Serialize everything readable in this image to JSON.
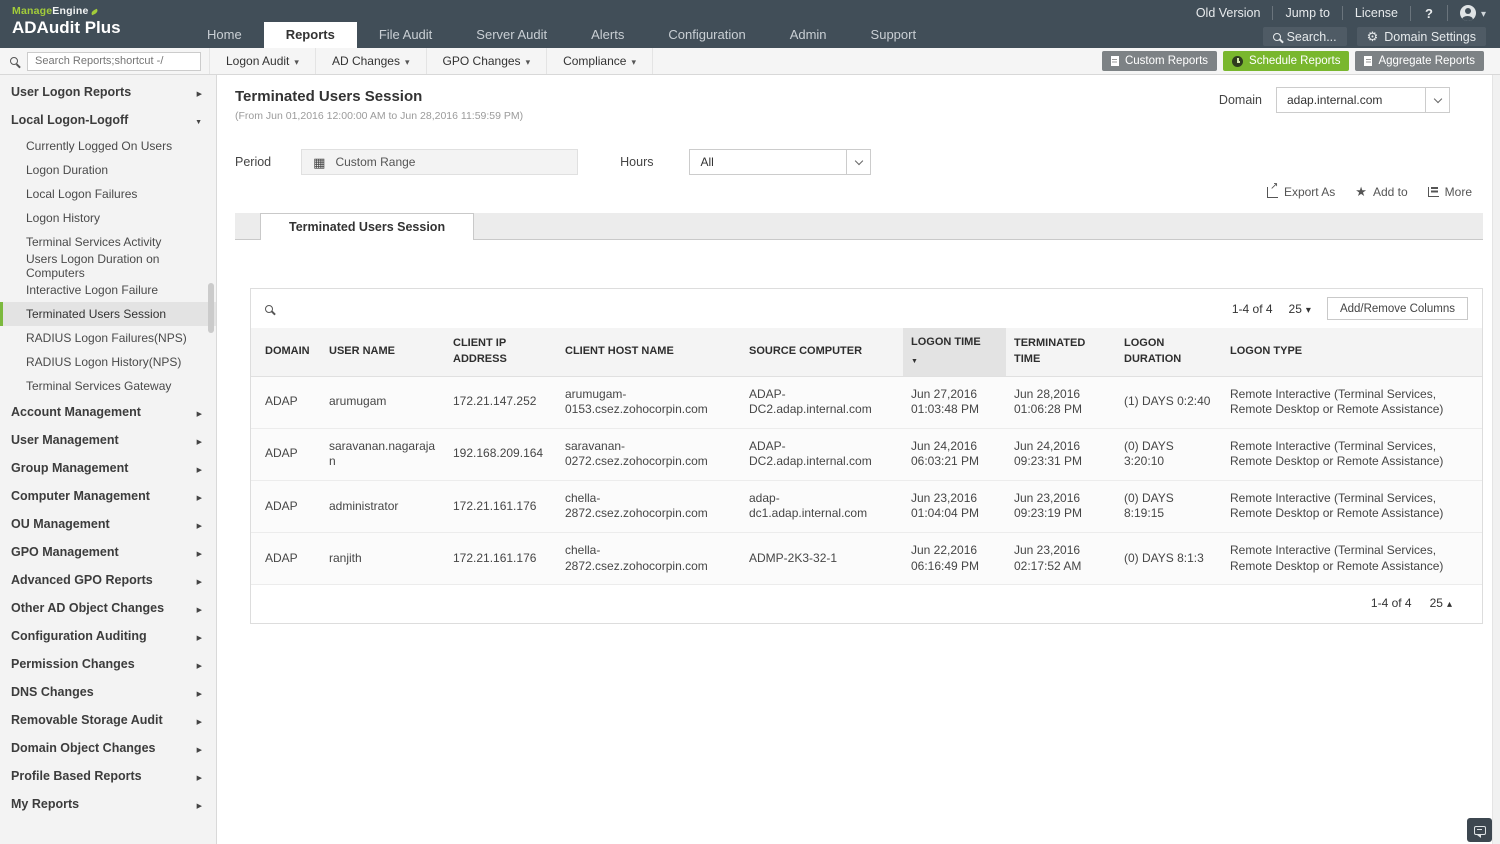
{
  "colors": {
    "header_bg": "#414e58",
    "accent_green": "#7cb93e",
    "button_green": "#79b72e",
    "button_gray": "#7d8285"
  },
  "brand": {
    "manage": "Manage",
    "engine": "Engine",
    "product": "ADAudit Plus"
  },
  "header": {
    "nav": [
      {
        "label": "Home"
      },
      {
        "label": "Reports",
        "active": true
      },
      {
        "label": "File Audit"
      },
      {
        "label": "Server Audit"
      },
      {
        "label": "Alerts"
      },
      {
        "label": "Configuration"
      },
      {
        "label": "Admin"
      },
      {
        "label": "Support"
      }
    ],
    "quick_links": [
      "Old Version",
      "Jump to",
      "License"
    ],
    "help_icon": "?",
    "search_label": "Search...",
    "domain_settings_label": "Domain Settings"
  },
  "toolbar": {
    "search_placeholder": "Search Reports;shortcut -/",
    "menus": [
      {
        "label": "Logon Audit"
      },
      {
        "label": "AD Changes"
      },
      {
        "label": "GPO Changes"
      },
      {
        "label": "Compliance"
      }
    ],
    "action_buttons": [
      {
        "label": "Custom Reports",
        "style": "gray",
        "icon": "report-icon"
      },
      {
        "label": "Schedule Reports",
        "style": "green",
        "icon": "clock-icon"
      },
      {
        "label": "Aggregate Reports",
        "style": "gray",
        "icon": "report-icon"
      }
    ]
  },
  "sidebar": {
    "items": [
      {
        "label": "User Logon Reports",
        "type": "section",
        "arrow": "right"
      },
      {
        "label": "Local Logon-Logoff",
        "type": "section",
        "arrow": "down"
      },
      {
        "label": "Currently Logged On Users",
        "type": "sub"
      },
      {
        "label": "Logon Duration",
        "type": "sub"
      },
      {
        "label": "Local Logon Failures",
        "type": "sub"
      },
      {
        "label": "Logon History",
        "type": "sub"
      },
      {
        "label": "Terminal Services Activity",
        "type": "sub"
      },
      {
        "label": "Users Logon Duration on Computers",
        "type": "sub"
      },
      {
        "label": "Interactive Logon Failure",
        "type": "sub"
      },
      {
        "label": "Terminated Users Session",
        "type": "sub",
        "active": true
      },
      {
        "label": "RADIUS Logon Failures(NPS)",
        "type": "sub"
      },
      {
        "label": "RADIUS Logon History(NPS)",
        "type": "sub"
      },
      {
        "label": "Terminal Services Gateway",
        "type": "sub"
      },
      {
        "label": "Account Management",
        "type": "section",
        "arrow": "right"
      },
      {
        "label": "User Management",
        "type": "section",
        "arrow": "right"
      },
      {
        "label": "Group Management",
        "type": "section",
        "arrow": "right"
      },
      {
        "label": "Computer Management",
        "type": "section",
        "arrow": "right"
      },
      {
        "label": "OU Management",
        "type": "section",
        "arrow": "right"
      },
      {
        "label": "GPO Management",
        "type": "section",
        "arrow": "right"
      },
      {
        "label": "Advanced GPO Reports",
        "type": "section",
        "arrow": "right"
      },
      {
        "label": "Other AD Object Changes",
        "type": "section",
        "arrow": "right"
      },
      {
        "label": "Configuration Auditing",
        "type": "section",
        "arrow": "right"
      },
      {
        "label": "Permission Changes",
        "type": "section",
        "arrow": "right"
      },
      {
        "label": "DNS Changes",
        "type": "section",
        "arrow": "right"
      },
      {
        "label": "Removable Storage Audit",
        "type": "section",
        "arrow": "right"
      },
      {
        "label": "Domain Object Changes",
        "type": "section",
        "arrow": "right"
      },
      {
        "label": "Profile Based Reports",
        "type": "section",
        "arrow": "right"
      },
      {
        "label": "My Reports",
        "type": "section",
        "arrow": "right"
      }
    ]
  },
  "report": {
    "title": "Terminated Users Session",
    "subtitle": "(From Jun 01,2016 12:00:00 AM to Jun 28,2016 11:59:59 PM)",
    "domain_label": "Domain",
    "domain_value": "adap.internal.com",
    "period_label": "Period",
    "period_value": "Custom Range",
    "hours_label": "Hours",
    "hours_value": "All",
    "actions": [
      {
        "label": "Export As",
        "icon": "export-icon"
      },
      {
        "label": "Add to",
        "icon": "star-icon"
      },
      {
        "label": "More",
        "icon": "more-icon"
      }
    ],
    "tab_label": "Terminated Users Session"
  },
  "table": {
    "range_text": "1-4 of 4",
    "page_size": "25",
    "add_remove_label": "Add/Remove Columns",
    "columns": [
      {
        "label": "DOMAIN"
      },
      {
        "label": "USER NAME"
      },
      {
        "label": "CLIENT IP ADDRESS"
      },
      {
        "label": "CLIENT HOST NAME"
      },
      {
        "label": "SOURCE COMPUTER"
      },
      {
        "label": "LOGON TIME",
        "sorted": true
      },
      {
        "label": "TERMINATED TIME"
      },
      {
        "label": "LOGON DURATION"
      },
      {
        "label": "LOGON TYPE"
      }
    ],
    "rows": [
      {
        "domain": "ADAP",
        "user": "arumugam",
        "ip": "172.21.147.252",
        "host": "arumugam-0153.csez.zohocorpin.com",
        "source": "ADAP-DC2.adap.internal.com",
        "logon": "Jun 27,2016 01:03:48 PM",
        "terminated": "Jun 28,2016 01:06:28 PM",
        "duration": "(1) DAYS 0:2:40",
        "type": "Remote Interactive (Terminal Services, Remote Desktop or Remote Assistance)"
      },
      {
        "domain": "ADAP",
        "user": "saravanan.nagarajan",
        "ip": "192.168.209.164",
        "host": "saravanan-0272.csez.zohocorpin.com",
        "source": "ADAP-DC2.adap.internal.com",
        "logon": "Jun 24,2016 06:03:21 PM",
        "terminated": "Jun 24,2016 09:23:31 PM",
        "duration": "(0) DAYS 3:20:10",
        "type": "Remote Interactive (Terminal Services, Remote Desktop or Remote Assistance)"
      },
      {
        "domain": "ADAP",
        "user": "administrator",
        "ip": "172.21.161.176",
        "host": "chella-2872.csez.zohocorpin.com",
        "source": "adap-dc1.adap.internal.com",
        "logon": "Jun 23,2016 01:04:04 PM",
        "terminated": "Jun 23,2016 09:23:19 PM",
        "duration": "(0) DAYS 8:19:15",
        "type": "Remote Interactive (Terminal Services, Remote Desktop or Remote Assistance)"
      },
      {
        "domain": "ADAP",
        "user": "ranjith",
        "ip": "172.21.161.176",
        "host": "chella-2872.csez.zohocorpin.com",
        "source": "ADMP-2K3-32-1",
        "logon": "Jun 22,2016 06:16:49 PM",
        "terminated": "Jun 23,2016 02:17:52 AM",
        "duration": "(0) DAYS 8:1:3",
        "type": "Remote Interactive (Terminal Services, Remote Desktop or Remote Assistance)"
      }
    ],
    "footer_range": "1-4 of 4",
    "footer_page_size": "25"
  }
}
